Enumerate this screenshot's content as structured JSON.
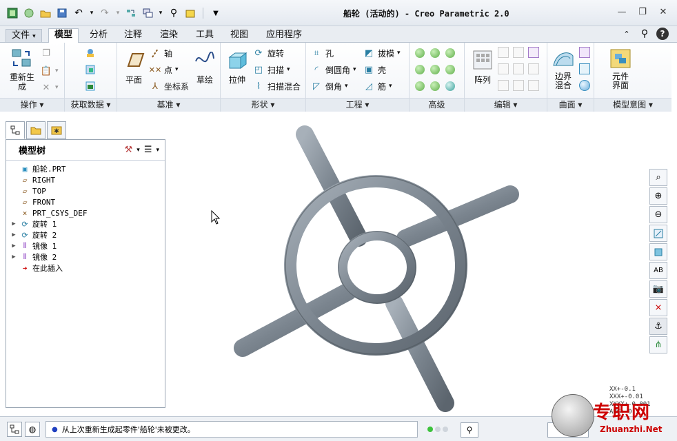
{
  "window": {
    "title": "船轮 (活动的) - Creo Parametric 2.0"
  },
  "tabs": [
    {
      "label": "文件",
      "arrow": "▾"
    },
    {
      "label": "模型"
    },
    {
      "label": "分析"
    },
    {
      "label": "注释"
    },
    {
      "label": "渲染"
    },
    {
      "label": "工具"
    },
    {
      "label": "视图"
    },
    {
      "label": "应用程序"
    }
  ],
  "ribbon": {
    "operations": {
      "regen": "重新生\n成",
      "footer": "操作 ▾"
    },
    "get_data": {
      "footer": "获取数据 ▾"
    },
    "datum": {
      "plane": "平面",
      "axis": "轴",
      "point": "点",
      "csys": "坐标系",
      "sketch": "草绘",
      "footer": "基准 ▾"
    },
    "shapes": {
      "extrude": "拉伸",
      "revolve": "旋转",
      "sweep": "扫描",
      "swept_blend": "扫描混合",
      "footer": "形状 ▾"
    },
    "engineering": {
      "hole": "孔",
      "round": "倒圆角",
      "chamfer": "倒角",
      "draft": "拔模",
      "shell": "壳",
      "rib": "筋",
      "footer": "工程 ▾"
    },
    "advanced": {
      "footer": "高级"
    },
    "editing": {
      "pattern": "阵列",
      "footer": "编辑 ▾"
    },
    "surfaces": {
      "boundary_blend": "边界\n混合",
      "footer": "曲面 ▾"
    },
    "model_intent": {
      "component_interface": "元件\n界面",
      "footer": "模型意图 ▾"
    }
  },
  "model_tree": {
    "title": "模型树",
    "items": [
      {
        "label": "船轮.PRT",
        "icon": "part-icon",
        "expandable": false
      },
      {
        "label": "RIGHT",
        "icon": "datum-plane-icon",
        "expandable": false
      },
      {
        "label": "TOP",
        "icon": "datum-plane-icon",
        "expandable": false
      },
      {
        "label": "FRONT",
        "icon": "datum-plane-icon",
        "expandable": false
      },
      {
        "label": "PRT_CSYS_DEF",
        "icon": "csys-icon",
        "expandable": false
      },
      {
        "label": "旋转 1",
        "icon": "revolve-icon",
        "expandable": true
      },
      {
        "label": "旋转 2",
        "icon": "revolve-icon",
        "expandable": true
      },
      {
        "label": "镜像 1",
        "icon": "mirror-icon",
        "expandable": true
      },
      {
        "label": "镜像 2",
        "icon": "mirror-icon",
        "expandable": true
      },
      {
        "label": "在此插入",
        "icon": "insert-arrow-icon",
        "expandable": false
      }
    ]
  },
  "status": {
    "message": "从上次重新生成起零件'船轮'未被更改。",
    "filter": ""
  },
  "tolerance": [
    "XX+-0.1",
    "XXX+-0.01",
    "XXXX+-0.001",
    "ANG+-0.5"
  ],
  "watermark": {
    "text": "专职网",
    "url": "Zhuanzhi.Net"
  },
  "colors": {
    "accent": "#4a7ab8",
    "model": "#7b858f",
    "status_green": "#3cc23c"
  }
}
